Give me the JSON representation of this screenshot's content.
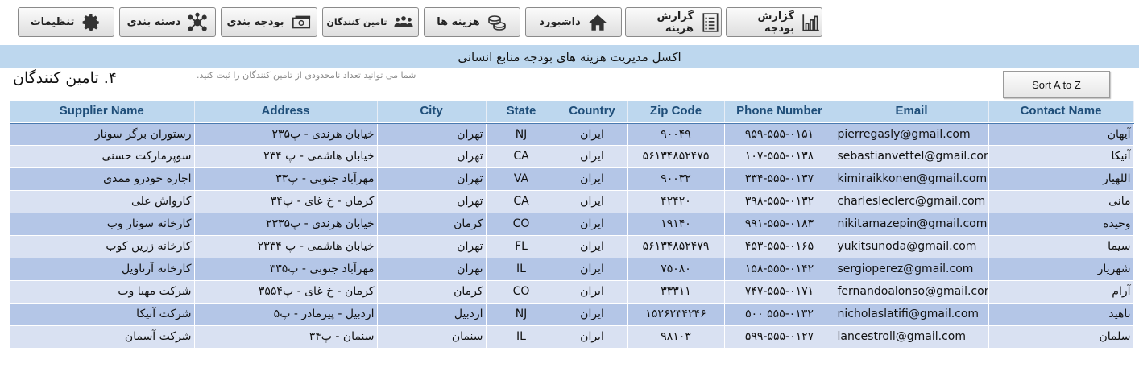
{
  "toolbar": {
    "buttons": [
      {
        "label": "تنظیمات",
        "icon": "gear-icon"
      },
      {
        "label": "دسته بندی",
        "icon": "network-icon"
      },
      {
        "label": "بودجه بندی",
        "icon": "money-icon"
      },
      {
        "label": "تامین کنندگان",
        "icon": "people-icon"
      },
      {
        "label": "هزینه ها",
        "icon": "coins-icon"
      },
      {
        "label": "داشبورد",
        "icon": "home-icon"
      },
      {
        "label": "گزارش هزینه",
        "icon": "report-icon"
      },
      {
        "label": "گزارش بودجه",
        "icon": "bar-chart-icon"
      }
    ]
  },
  "banner": {
    "title": "اکسل مدیریت هزینه های بودجه منابع انسانی"
  },
  "section": {
    "title": "۴. تامین کنندگان",
    "note": "شما می توانید تعداد نامحدودی از تامین کنندگان را ثبت کنید."
  },
  "sort_button": {
    "label": "Sort A to Z"
  },
  "table": {
    "headers": {
      "supplier": "Supplier Name",
      "address": "Address",
      "city": "City",
      "state": "State",
      "country": "Country",
      "zip": "Zip Code",
      "phone": "Phone Number",
      "email": "Email",
      "contact": "Contact Name"
    },
    "rows": [
      {
        "supplier": "رستوران برگر سونار",
        "address": "خیابان هرندی - پ۲۳۵",
        "city": "تهران",
        "state": "NJ",
        "country": "ایران",
        "zip": "۹۰۰۴۹",
        "phone": "۹۵۹-۵۵۵-۰۱۵۱",
        "email": "pierregasly@gmail.com",
        "contact": "آیهان"
      },
      {
        "supplier": "سوپرمارکت حسنی",
        "address": "خیابان هاشمی - پ ۲۳۴",
        "city": "تهران",
        "state": "CA",
        "country": "ایران",
        "zip": "۵۶۱۳۴۸۵۲۴۷۵",
        "phone": "۱۰۷-۵۵۵-۰۱۳۸",
        "email": "sebastianvettel@gmail.com",
        "contact": "آنیکا"
      },
      {
        "supplier": "اجاره خودرو ممدی",
        "address": "مهرآباد جنوبی - پ۳۳",
        "city": "تهران",
        "state": "VA",
        "country": "ایران",
        "zip": "۹۰۰۳۲",
        "phone": "۳۳۴-۵۵۵-۰۱۳۷",
        "email": "kimiraikkonen@gmail.com",
        "contact": "اللهیار"
      },
      {
        "supplier": "کارواش علی",
        "address": "کرمان - خ غای - پ۳۴",
        "city": "تهران",
        "state": "CA",
        "country": "ایران",
        "zip": "۴۲۴۲۰",
        "phone": "۳۹۸-۵۵۵-۰۱۳۲",
        "email": "charlesleclerc@gmail.com",
        "contact": "مانی"
      },
      {
        "supplier": "کارخانه سونار وب",
        "address": "خیابان هرندی - پ۲۳۳۵",
        "city": "کرمان",
        "state": "CO",
        "country": "ایران",
        "zip": "۱۹۱۴۰",
        "phone": "۹۹۱-۵۵۵-۰۱۸۳",
        "email": "nikitamazepin@gmail.com",
        "contact": "وحیده"
      },
      {
        "supplier": "کارخانه زرین کوب",
        "address": "خیابان هاشمی - پ ۲۳۳۴",
        "city": "تهران",
        "state": "FL",
        "country": "ایران",
        "zip": "۵۶۱۳۴۸۵۲۴۷۹",
        "phone": "۴۵۳-۵۵۵-۰۱۶۵",
        "email": "yukitsunoda@gmail.com",
        "contact": "سیما"
      },
      {
        "supplier": "کارخانه آرتاویل",
        "address": "مهرآباد جنوبی - پ۳۳۵",
        "city": "تهران",
        "state": "IL",
        "country": "ایران",
        "zip": "۷۵۰۸۰",
        "phone": "۱۵۸-۵۵۵-۰۱۴۲",
        "email": "sergioperez@gmail.com",
        "contact": "شهریار"
      },
      {
        "supplier": "شرکت مهیا وب",
        "address": "کرمان - خ غای - پ۳۵۵۴",
        "city": "کرمان",
        "state": "CO",
        "country": "ایران",
        "zip": "۳۳۳۱۱",
        "phone": "۷۴۷-۵۵۵-۰۱۷۱",
        "email": "fernandoalonso@gmail.com",
        "contact": "آرام"
      },
      {
        "supplier": "شرکت آنیکا",
        "address": "اردبیل - پیرمادر - پ۵",
        "city": "اردبیل",
        "state": "NJ",
        "country": "ایران",
        "zip": "۱۵۲۶۲۳۴۲۴۶",
        "phone": "۵۰۰ ۵۵۵-۰۱۳۲",
        "email": "nicholaslatifi@gmail.com",
        "contact": "ناهید"
      },
      {
        "supplier": "شرکت آسمان",
        "address": "سنمان - پ۳۴",
        "city": "سنمان",
        "state": "IL",
        "country": "ایران",
        "zip": "۹۸۱۰۳",
        "phone": "۵۹۹-۵۵۵-۰۱۲۷",
        "email": "lancestroll@gmail.com",
        "contact": "سلمان"
      }
    ]
  }
}
